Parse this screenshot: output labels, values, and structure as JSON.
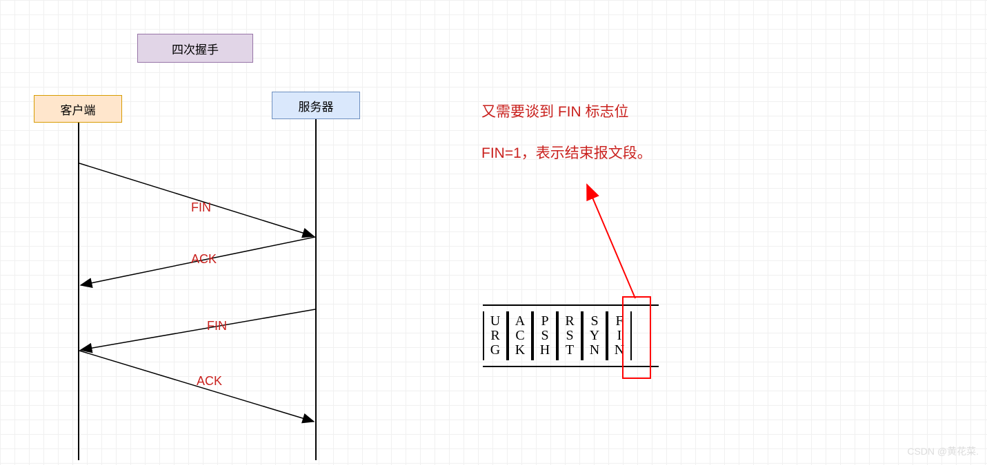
{
  "title": "四次握手",
  "client": "客户端",
  "server": "服务器",
  "messages": {
    "m1": "FIN",
    "m2": "ACK",
    "m3": "FIN",
    "m4": "ACK"
  },
  "note": {
    "line1": "又需要谈到 FIN 标志位",
    "line2": "FIN=1，表示结束报文段。"
  },
  "flags": {
    "f1": {
      "a": "U",
      "b": "R",
      "c": "G"
    },
    "f2": {
      "a": "A",
      "b": "C",
      "c": "K"
    },
    "f3": {
      "a": "P",
      "b": "S",
      "c": "H"
    },
    "f4": {
      "a": "R",
      "b": "S",
      "c": "T"
    },
    "f5": {
      "a": "S",
      "b": "Y",
      "c": "N"
    },
    "f6": {
      "a": "F",
      "b": "I",
      "c": "N"
    }
  },
  "watermark": "CSDN @黄花菜."
}
